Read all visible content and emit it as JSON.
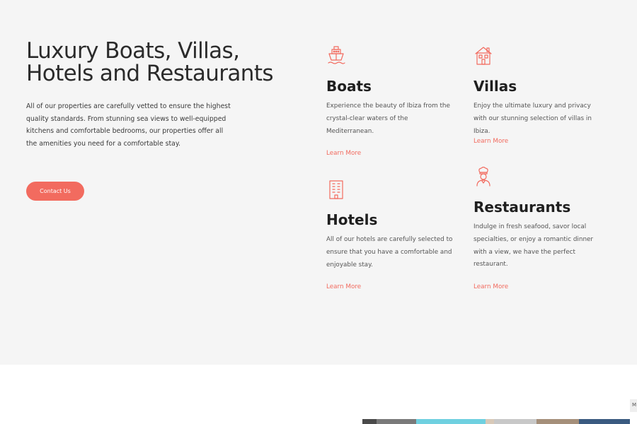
{
  "hero": {
    "headline": "Luxury Boats, Villas, Hotels and Restaurants",
    "intro": "All of our properties are carefully vetted to ensure the highest quality standards. From stunning sea views to well-equipped kitchens and comfortable bedrooms, our properties offer all the amenities you need for a comfortable stay.",
    "contact_label": "Contact Us"
  },
  "cards": [
    {
      "title": "Boats",
      "icon": "boat-icon",
      "description": "Experience the beauty of Ibiza from the crystal-clear waters of the Mediterranean.",
      "link_label": "Learn More"
    },
    {
      "title": "Villas",
      "icon": "house-icon",
      "description": "Enjoy the ultimate luxury and privacy with our stunning selection of villas in Ibiza.",
      "link_label": "Learn More"
    },
    {
      "title": "Hotels",
      "icon": "hotel-building-icon",
      "description": "All of our hotels are carefully selected to ensure that you have a comfortable and enjoyable stay.",
      "link_label": "Learn More"
    },
    {
      "title": "Restaurants",
      "icon": "chef-icon",
      "description": "Indulge in fresh seafood, savor local specialties, or enjoy a romantic dinner with a view, we have the perfect restaurant.",
      "link_label": "Learn More"
    }
  ],
  "side_tab": {
    "label": "M"
  },
  "colors": {
    "accent": "#f26b5f",
    "hero_background": "#f5f5f5",
    "heading": "#2b2b2b",
    "body_text": "#555555"
  }
}
